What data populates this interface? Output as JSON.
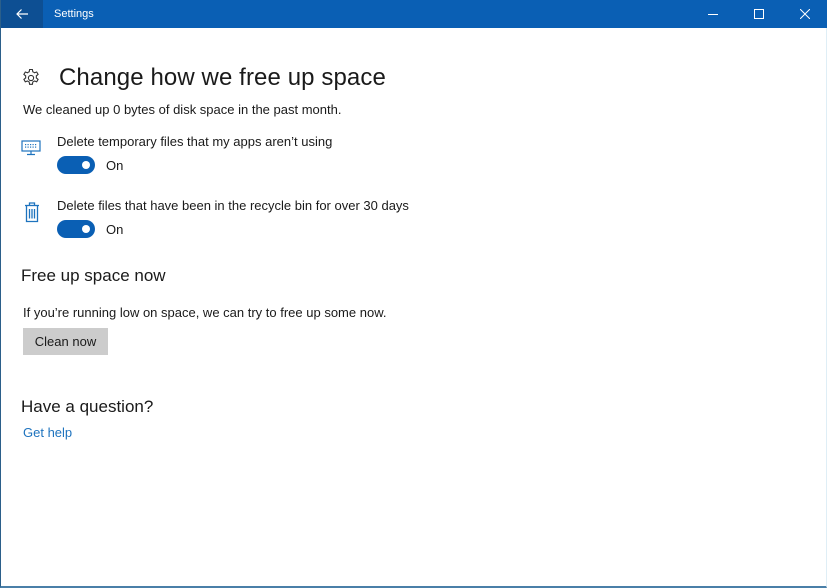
{
  "window": {
    "title": "Settings",
    "accent_color": "#0a5fb4",
    "controls": {
      "minimize": "minimize-icon",
      "maximize": "maximize-icon",
      "close": "close-icon"
    }
  },
  "page": {
    "title": "Change how we free up space",
    "icon": "gear-icon",
    "summary": "We cleaned up 0 bytes of disk space in the past month."
  },
  "settings": [
    {
      "icon": "monitor-icon",
      "label": "Delete temporary files that my apps aren’t using",
      "state": "On",
      "enabled": true
    },
    {
      "icon": "recycle-bin-icon",
      "label": "Delete files that have been in the recycle bin for over 30 days",
      "state": "On",
      "enabled": true
    }
  ],
  "free_up": {
    "heading": "Free up space now",
    "description": "If you’re running low on space, we can try to free up some now.",
    "button_label": "Clean now"
  },
  "help": {
    "heading": "Have a question?",
    "link_label": "Get help"
  }
}
